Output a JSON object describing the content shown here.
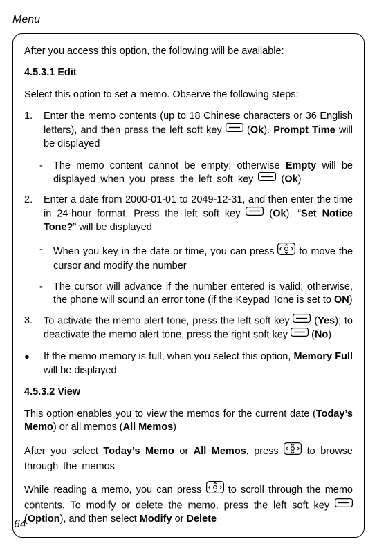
{
  "head": "Menu",
  "intro": "After you access this option, the following will be available:",
  "h1": "4.5.3.1 Edit",
  "edit_intro": "Select this option to set a memo. Observe the following steps:",
  "s1": {
    "n": "1.",
    "a": "Enter the memo contents (up to 18 Chinese characters or 36 English letters), and then press the left soft key ",
    "b": " (",
    "ok": "Ok",
    "c": "). ",
    "pt": "Prompt Time",
    "d": " will be displayed"
  },
  "s1a": {
    "dash": "-",
    "a": "The memo content cannot be empty; otherwise ",
    "emp": "Empty",
    "b": " will be displayed when you press the left soft key ",
    "c": " (",
    "ok": "Ok",
    "d": ")"
  },
  "s2": {
    "n": "2.",
    "a": "Enter a date from 2000-01-01 to 2049-12-31, and then enter the time in 24-hour format. Press the left soft key ",
    "b": " (",
    "ok": "Ok",
    "c": "). “",
    "snt": "Set Notice Tone?",
    "d": "” will be displayed"
  },
  "s2a": {
    "dash": "-",
    "a": "When you key in the date or time, you can press ",
    "b": " to move the cursor and modify the number"
  },
  "s2b": {
    "dash": "-",
    "a": "The cursor will advance if the number entered is valid; otherwise, the phone will sound an error tone (if the Keypad Tone is set to ",
    "on": "ON",
    "b": ")"
  },
  "s3": {
    "n": "3.",
    "a": "To activate the memo alert tone, press the left soft key ",
    "b": " (",
    "yes": "Yes",
    "c": "); to deactivate the memo alert tone, press the right soft key ",
    "d": " (",
    "no": "No",
    "e": ")"
  },
  "s4": {
    "bul": "●",
    "a": "If the memo memory is full, when you select this option, ",
    "mf": "Memory Full",
    "b": " will be displayed"
  },
  "h2": "4.5.3.2 View",
  "v_intro_a": "This option enables you to view the memos for the current date (",
  "tm": "Today’s Memo",
  "v_intro_b": ") or all memos (",
  "am": "All Memos",
  "v_intro_c": ")",
  "v2_a": "After you select ",
  "v2_b": " or ",
  "v2_c": ", press ",
  "v2_d": " to browse through the memos",
  "v3_a": "While reading a memo, you can press ",
  "v3_b": " to scroll through the memo contents. To modify or delete the memo, press the left soft key ",
  "v3_c": " (",
  "opt": "Option",
  "v3_d": "), and then select ",
  "mod": "Modify",
  "v3_e": " or ",
  "del": "Delete",
  "pagenum": "64"
}
